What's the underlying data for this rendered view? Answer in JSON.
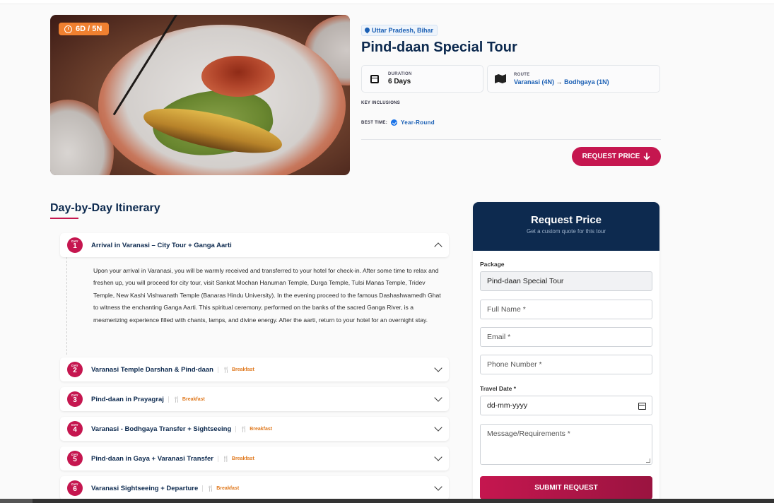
{
  "tour": {
    "badge": "6D / 5N",
    "location": "Uttar Pradesh, Bihar",
    "title": "Pind-daan Special Tour",
    "duration_label": "DURATION",
    "duration_value": "6 Days",
    "route_label": "ROUTE",
    "route_from": "Varanasi (4N)",
    "route_arrow": "→",
    "route_to": "Bodhgaya (1N)",
    "key_inclusions_label": "KEY INCLUSIONS",
    "best_time_label": "BEST TIME:",
    "best_time_value": "Year-Round",
    "request_btn": "REQUEST PRICE"
  },
  "itinerary": {
    "title": "Day-by-Day Itinerary",
    "day_label": "DAY",
    "days": [
      {
        "num": "1",
        "title": "Arrival in Varanasi – City Tour + Ganga Aarti",
        "meal": "",
        "expanded": true,
        "body": "Upon your arrival in Varanasi, you will be warmly received and transferred to your hotel for check-in. After some time to relax and freshen up, you will proceed for city tour, visit Sankat Mochan Hanuman Temple, Durga Temple, Tulsi Manas Temple, Tridev Temple, New Kashi Vishwanath Temple (Banaras Hindu University). In the evening proceed to the famous Dashashwamedh Ghat to witness the enchanting Ganga Aarti. This spiritual ceremony, performed on the banks of the sacred Ganga River, is a mesmerizing experience filled with chants, lamps, and divine energy. After the aarti, return to your hotel for an overnight stay."
      },
      {
        "num": "2",
        "title": "Varanasi Temple Darshan & Pind-daan",
        "meal": "Breakfast"
      },
      {
        "num": "3",
        "title": "Pind-daan in Prayagraj",
        "meal": "Breakfast"
      },
      {
        "num": "4",
        "title": "Varanasi - Bodhgaya Transfer + Sightseeing",
        "meal": "Breakfast"
      },
      {
        "num": "5",
        "title": "Pind-daan in Gaya + Varanasi Transfer",
        "meal": "Breakfast"
      },
      {
        "num": "6",
        "title": "Varanasi Sightseeing + Departure",
        "meal": "Breakfast"
      }
    ]
  },
  "form": {
    "heading": "Request Price",
    "subheading": "Get a custom quote for this tour",
    "package_label": "Package",
    "package_value": "Pind-daan Special Tour",
    "full_name_placeholder": "Full Name *",
    "email_placeholder": "Email *",
    "phone_placeholder": "Phone Number *",
    "travel_date_label": "Travel Date *",
    "travel_date_value": "dd-mm-yyyy",
    "message_placeholder": "Message/Requirements *",
    "submit": "SUBMIT REQUEST"
  },
  "icons": {
    "clock": "clock-icon",
    "pin": "location-pin-icon",
    "calendar": "calendar-icon",
    "map": "map-icon",
    "check": "check-circle-icon",
    "arrow_down": "arrow-down-icon",
    "cutlery": "cutlery-icon",
    "chevron": "chevron-icon"
  },
  "colors": {
    "navy": "#0d2a4f",
    "accent": "#c5164f",
    "orange": "#f08030",
    "link_blue": "#1a5fb4"
  }
}
